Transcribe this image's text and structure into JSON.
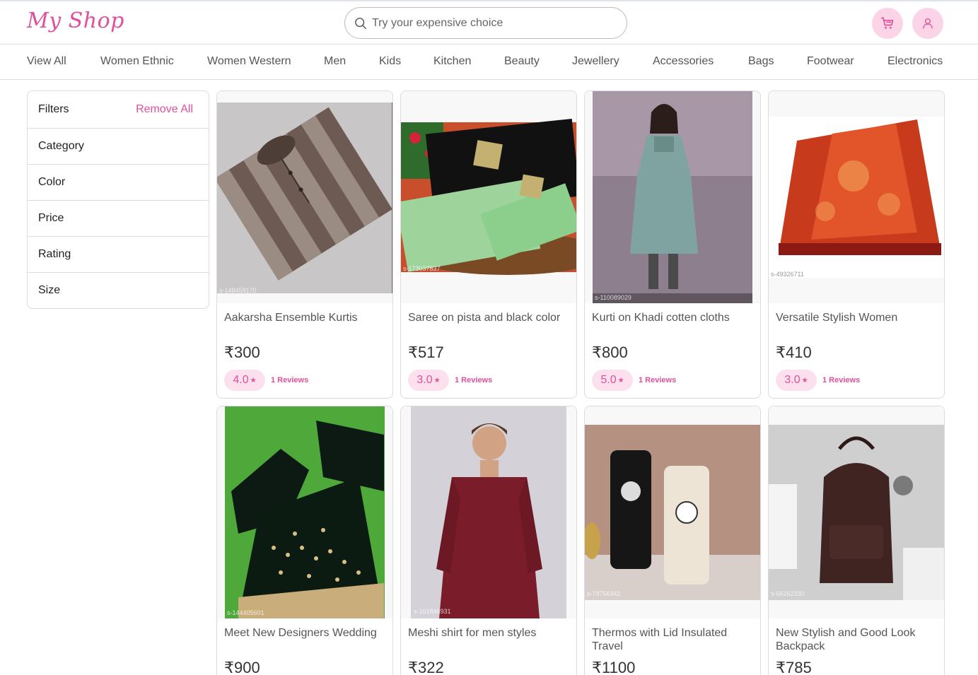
{
  "header": {
    "logo": "My Shop",
    "search_placeholder": "Try your expensive choice",
    "accent_color": "#e0509a"
  },
  "categories": [
    "View All",
    "Women Ethnic",
    "Women Western",
    "Men",
    "Kids",
    "Kitchen",
    "Beauty",
    "Jewellery",
    "Accessories",
    "Bags",
    "Footwear",
    "Electronics"
  ],
  "filters": {
    "title": "Filters",
    "remove_all": "Remove All",
    "items": [
      "Category",
      "Color",
      "Price",
      "Rating",
      "Size"
    ]
  },
  "products": [
    {
      "name": "Aakarsha Ensemble Kurtis",
      "price": "₹300",
      "rating": "4.0",
      "reviews": "1 Reviews",
      "sku": "s-148459170"
    },
    {
      "name": "Saree on pista and black color",
      "price": "₹517",
      "rating": "3.0",
      "reviews": "1 Reviews",
      "sku": "s-173037837"
    },
    {
      "name": "Kurti on Khadi cotten cloths",
      "price": "₹800",
      "rating": "5.0",
      "reviews": "1 Reviews",
      "sku": "s-110089029"
    },
    {
      "name": "Versatile Stylish Women",
      "price": "₹410",
      "rating": "3.0",
      "reviews": "1 Reviews",
      "sku": "s-49326711"
    },
    {
      "name": "Meet New Designers Wedding",
      "price": "₹900",
      "sku": "s-144405601"
    },
    {
      "name": "Meshi shirt for men styles",
      "price": "₹322",
      "sku": "s-161846931"
    },
    {
      "name": "Thermos with Lid Insulated Travel",
      "price": "₹1100",
      "sku": "s-79756942"
    },
    {
      "name": "New Stylish and Good Look Backpack",
      "price": "₹785",
      "sku": "s-66262330"
    }
  ]
}
